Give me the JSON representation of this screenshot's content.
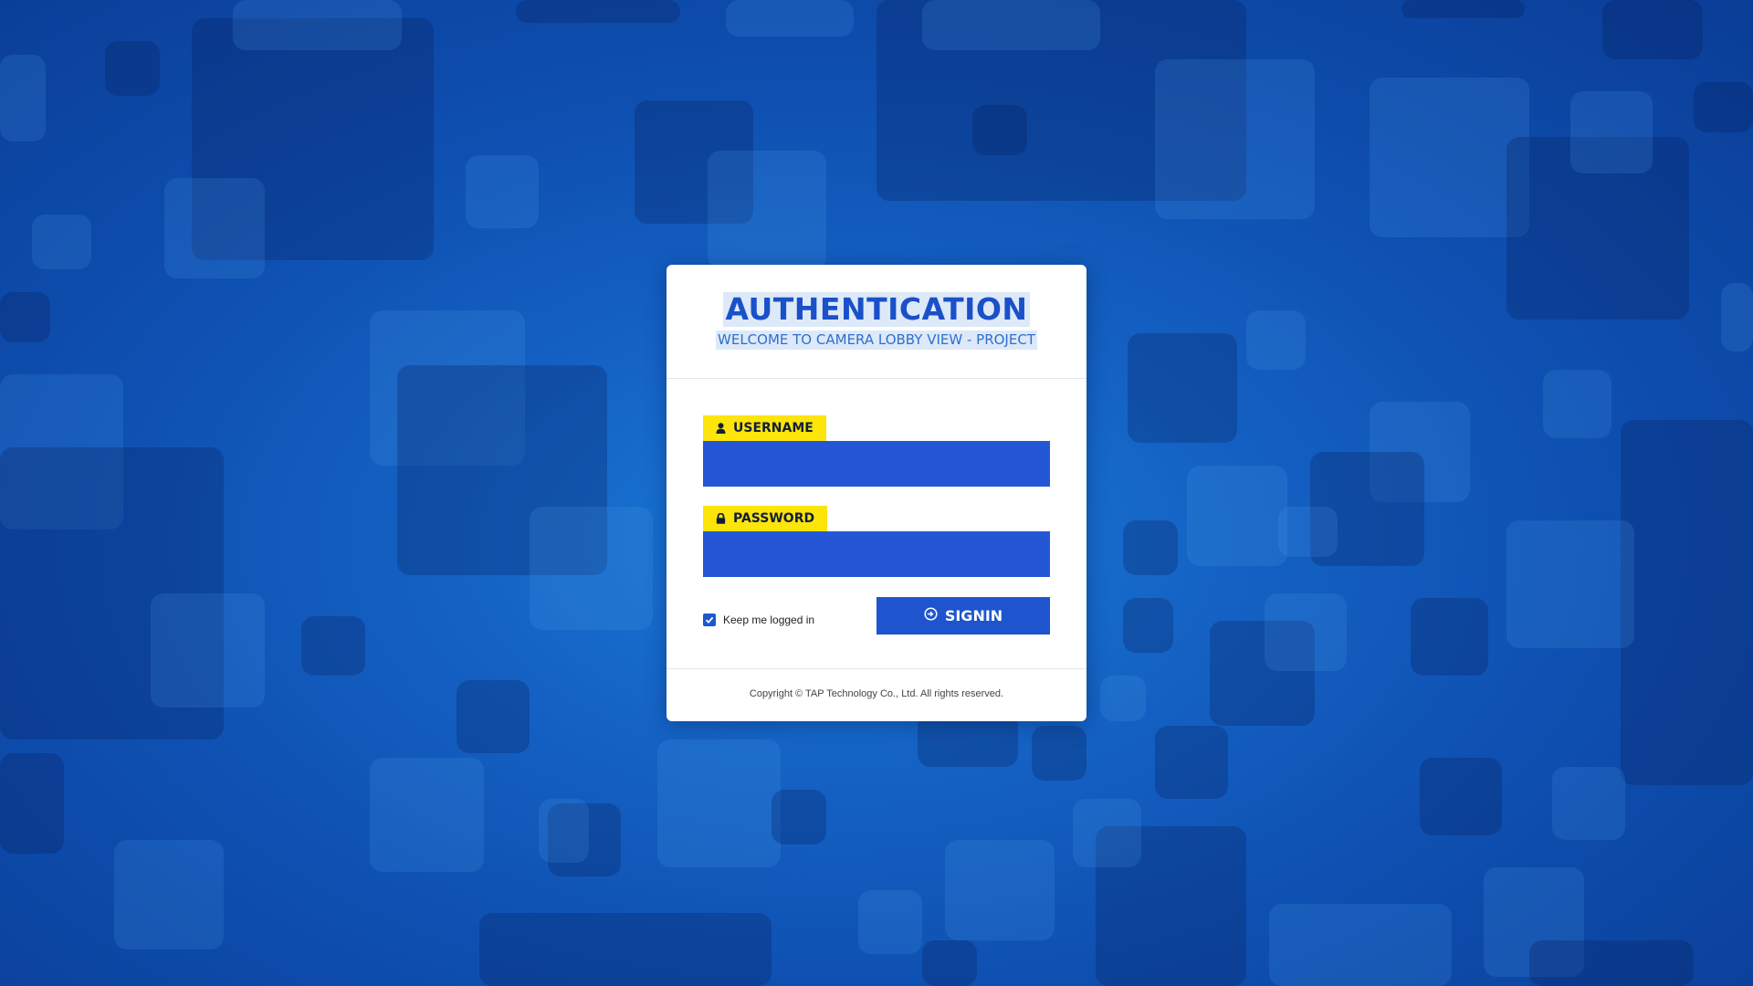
{
  "header": {
    "title": "AUTHENTICATION",
    "subtitle": "WELCOME TO CAMERA LOBBY VIEW - PROJECT"
  },
  "form": {
    "username_label": "USERNAME",
    "username_icon": "user-icon",
    "password_label": "PASSWORD",
    "password_icon": "lock-icon",
    "username_value": "",
    "password_value": "",
    "remember_label": "Keep me logged in",
    "remember_checked": true,
    "signin_label": "SIGNIN",
    "signin_icon": "sign-in-icon"
  },
  "footer": {
    "copyright": "Copyright © TAP Technology Co., Ltd. All rights reserved."
  },
  "colors": {
    "accent": "#1e55cf",
    "label_highlight": "#fde40a",
    "background": "#1462c4"
  }
}
